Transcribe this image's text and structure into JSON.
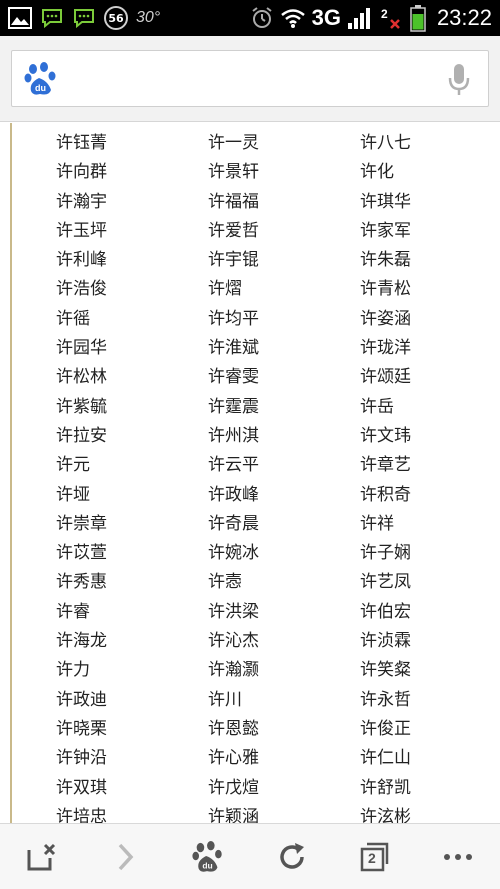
{
  "status_bar": {
    "time": "23:22",
    "network": "3G",
    "badge_number": "56",
    "temperature": "30°",
    "sim_marker": "2"
  },
  "search": {
    "placeholder": "",
    "value": ""
  },
  "names": [
    "许钰菁",
    "许一灵",
    "许八七",
    "许向群",
    "许景轩",
    "许化",
    "许瀚宇",
    "许福福",
    "许琪华",
    "许玉坪",
    "许爱哲",
    "许家军",
    "许利峰",
    "许宇锟",
    "许朱磊",
    "许浩俊",
    "许熠",
    "许青松",
    "许徭",
    "许均平",
    "许姿涵",
    "许园华",
    "许淮斌",
    "许珑洋",
    "许松林",
    "许睿雯",
    "许颂廷",
    "许紫毓",
    "许霆震",
    "许岳",
    "许拉安",
    "许州淇",
    "许文玮",
    "许元",
    "许云平",
    "许章艺",
    "许垭",
    "许政峰",
    "许积奇",
    "许崇章",
    "许奇晨",
    "许祥",
    "许苡萱",
    "许婉冰",
    "许子娴",
    "许秀惠",
    "许悫",
    "许艺凤",
    "许睿",
    "许洪梁",
    "许伯宏",
    "许海龙",
    "许沁杰",
    "许浈霖",
    "许力",
    "许瀚灏",
    "许笑粲",
    "许政迪",
    "许川",
    "许永哲",
    "许晓栗",
    "许恩懿",
    "许俊正",
    "许钟沿",
    "许心雅",
    "许仁山",
    "许双琪",
    "许戊煊",
    "许舒凯",
    "许培忠",
    "许颖涵",
    "许泫彬"
  ],
  "toolbar": {
    "tab_count": "2"
  }
}
